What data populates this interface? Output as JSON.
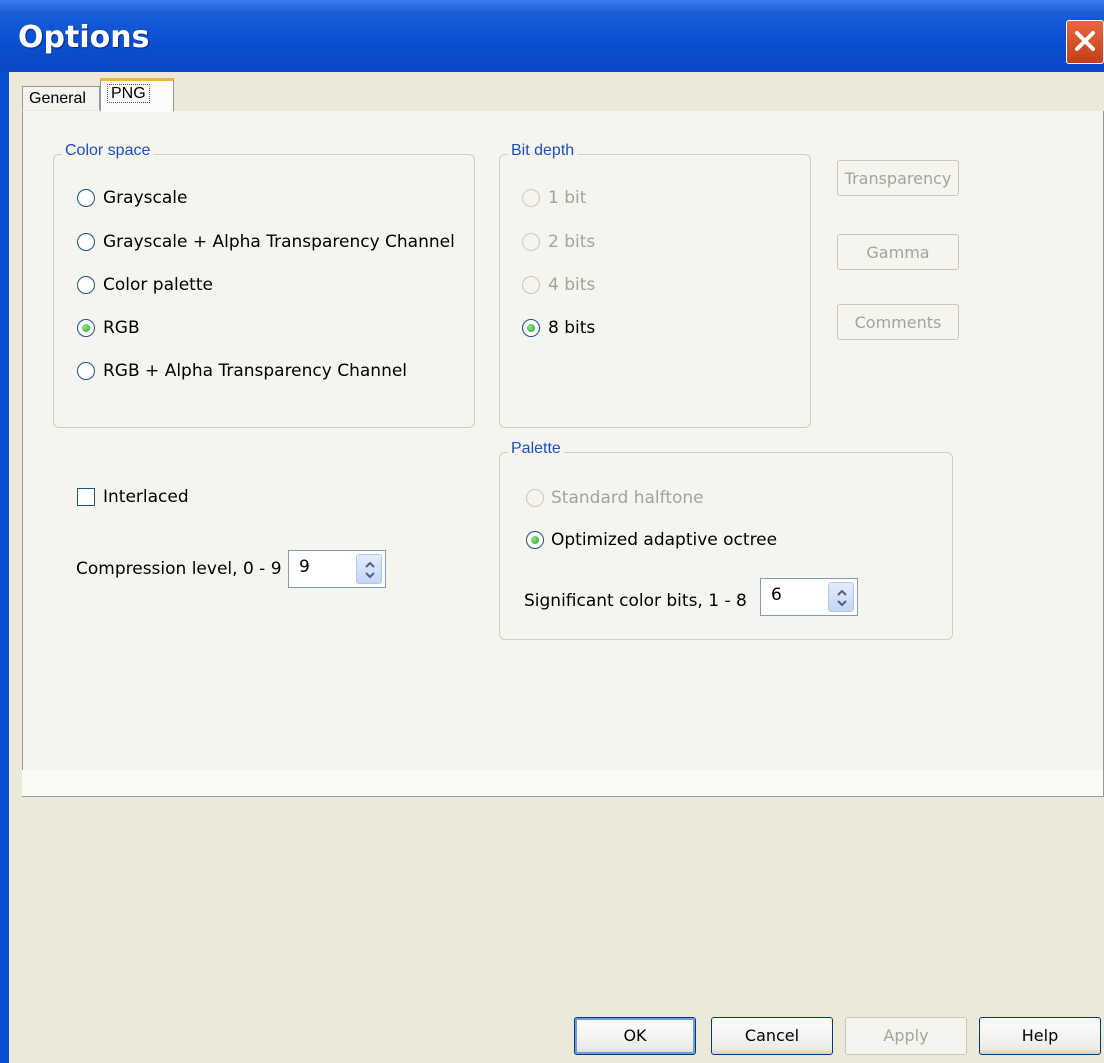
{
  "window": {
    "title": "Options"
  },
  "tabs": [
    {
      "label": "General",
      "selected": false
    },
    {
      "label": "PNG",
      "selected": true
    }
  ],
  "color_space": {
    "label": "Color space",
    "options": [
      {
        "label": "Grayscale",
        "checked": false
      },
      {
        "label": "Grayscale + Alpha Transparency Channel",
        "checked": false
      },
      {
        "label": "Color palette",
        "checked": false
      },
      {
        "label": "RGB",
        "checked": true
      },
      {
        "label": "RGB + Alpha Transparency Channel",
        "checked": false
      }
    ]
  },
  "bit_depth": {
    "label": "Bit depth",
    "options": [
      {
        "label": "1 bit",
        "checked": false,
        "enabled": false
      },
      {
        "label": "2 bits",
        "checked": false,
        "enabled": false
      },
      {
        "label": "4 bits",
        "checked": false,
        "enabled": false
      },
      {
        "label": "8 bits",
        "checked": true,
        "enabled": true
      }
    ]
  },
  "side_buttons": {
    "transparency": "Transparency",
    "gamma": "Gamma",
    "comments": "Comments"
  },
  "interlaced": {
    "label": "Interlaced",
    "checked": false
  },
  "compression": {
    "label": "Compression level, 0 - 9",
    "value": "9"
  },
  "palette": {
    "label": "Palette",
    "standard_halftone": "Standard halftone",
    "optimized": "Optimized adaptive octree",
    "significant_bits_label": "Significant color bits, 1 - 8",
    "significant_bits_value": "6"
  },
  "buttons": {
    "ok": "OK",
    "cancel": "Cancel",
    "apply": "Apply",
    "help": "Help"
  },
  "colors": {
    "title_bar": "#0a4fd0",
    "group_label": "#1f4fbd",
    "disabled_text": "#a4a498"
  }
}
